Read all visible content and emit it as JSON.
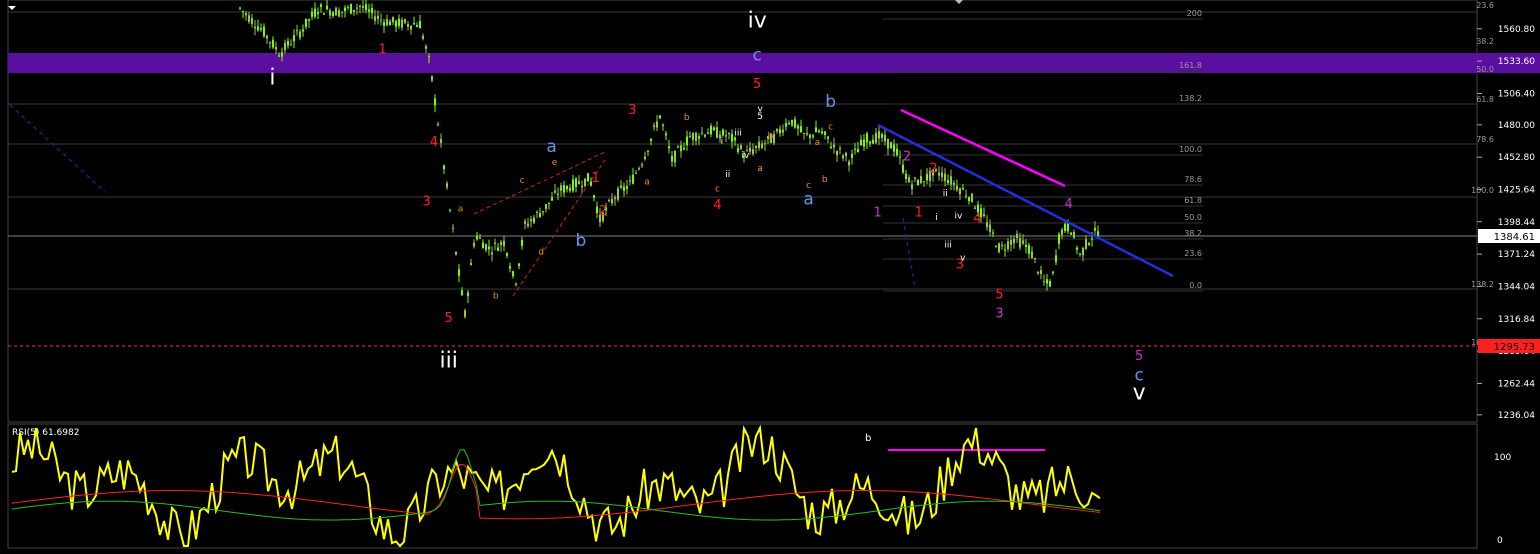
{
  "chart_data": [
    {
      "type": "candlestick",
      "panel": "price",
      "ylim": [
        1230,
        1585
      ],
      "yticks": [
        "1560.80",
        "1533.60",
        "1506.40",
        "1480.00",
        "1452.80",
        "1425.64",
        "1398.44",
        "1371.24",
        "1344.04",
        "1316.84",
        "1289.64",
        "1262.44",
        "1236.04"
      ],
      "current_price": "1384.61",
      "marked_price": "1295.73",
      "colors": {
        "bull": "#7cfc00",
        "bear": "#9acd32",
        "accent": "#ffffff"
      },
      "wave_labels": [
        {
          "t": "i",
          "x": 0.18,
          "price": 1514,
          "color": "#ffffff",
          "size": "large"
        },
        {
          "t": "iii",
          "x": 0.3,
          "price": 1276,
          "color": "#ffffff",
          "size": "large"
        },
        {
          "t": "iv",
          "x": 0.51,
          "price": 1562,
          "color": "#ffffff",
          "size": "large"
        },
        {
          "t": "v",
          "x": 0.77,
          "price": 1249,
          "color": "#ffffff",
          "size": "large"
        },
        {
          "t": "c",
          "x": 0.51,
          "price": 1534,
          "color": "#6495ed",
          "size": "medium"
        },
        {
          "t": "5",
          "x": 0.51,
          "price": 1511,
          "color": "#ff2020",
          "size": "small"
        },
        {
          "t": "a",
          "x": 0.37,
          "price": 1457,
          "color": "#6495ed",
          "size": "medium"
        },
        {
          "t": "b",
          "x": 0.39,
          "price": 1378,
          "color": "#6495ed",
          "size": "medium"
        },
        {
          "t": "b",
          "x": 0.56,
          "price": 1495,
          "color": "#6495ed",
          "size": "medium"
        },
        {
          "t": "a",
          "x": 0.545,
          "price": 1413,
          "color": "#6495ed",
          "size": "medium"
        },
        {
          "t": "c",
          "x": 0.77,
          "price": 1265,
          "color": "#6495ed",
          "size": "medium"
        },
        {
          "t": "5",
          "x": 0.77,
          "price": 1282,
          "color": "#cc33cc",
          "size": "small"
        },
        {
          "t": "1",
          "x": 0.255,
          "price": 1540,
          "color": "#ff2020",
          "size": "small"
        },
        {
          "t": "4",
          "x": 0.29,
          "price": 1462,
          "color": "#ff2020",
          "size": "small"
        },
        {
          "t": "3",
          "x": 0.285,
          "price": 1412,
          "color": "#ff2020",
          "size": "small"
        },
        {
          "t": "5",
          "x": 0.3,
          "price": 1314,
          "color": "#ff2020",
          "size": "small"
        },
        {
          "t": "3",
          "x": 0.425,
          "price": 1489,
          "color": "#ff2020",
          "size": "small"
        },
        {
          "t": "1",
          "x": 0.4,
          "price": 1432,
          "color": "#ff2020",
          "size": "small"
        },
        {
          "t": "2",
          "x": 0.405,
          "price": 1404,
          "color": "#ff2020",
          "size": "small"
        },
        {
          "t": "4",
          "x": 0.483,
          "price": 1409,
          "color": "#ff2020",
          "size": "small"
        },
        {
          "t": "1",
          "x": 0.62,
          "price": 1403,
          "color": "#ff2020",
          "size": "small"
        },
        {
          "t": "2",
          "x": 0.63,
          "price": 1440,
          "color": "#ff2020",
          "size": "small"
        },
        {
          "t": "4",
          "x": 0.66,
          "price": 1398,
          "color": "#ff2020",
          "size": "small"
        },
        {
          "t": "3",
          "x": 0.648,
          "price": 1359,
          "color": "#ff2020",
          "size": "small"
        },
        {
          "t": "5",
          "x": 0.675,
          "price": 1334,
          "color": "#ff2020",
          "size": "small"
        },
        {
          "t": "1",
          "x": 0.592,
          "price": 1403,
          "color": "#cc33cc",
          "size": "small"
        },
        {
          "t": "2",
          "x": 0.612,
          "price": 1450,
          "color": "#cc33cc",
          "size": "small"
        },
        {
          "t": "3",
          "x": 0.675,
          "price": 1318,
          "color": "#cc33cc",
          "size": "small"
        },
        {
          "t": "4",
          "x": 0.722,
          "price": 1410,
          "color": "#cc33cc",
          "size": "small"
        },
        {
          "t": "e",
          "x": 0.372,
          "price": 1446,
          "color": "#e09020",
          "size": "tiny"
        },
        {
          "t": "c",
          "x": 0.35,
          "price": 1431,
          "color": "#e09020",
          "size": "tiny"
        },
        {
          "t": "a",
          "x": 0.308,
          "price": 1407,
          "color": "#e09020",
          "size": "tiny"
        },
        {
          "t": "d",
          "x": 0.363,
          "price": 1371,
          "color": "#e09020",
          "size": "tiny"
        },
        {
          "t": "b",
          "x": 0.332,
          "price": 1334,
          "color": "#e09020",
          "size": "tiny"
        },
        {
          "t": "b",
          "x": 0.462,
          "price": 1484,
          "color": "#e09020",
          "size": "tiny"
        },
        {
          "t": "a",
          "x": 0.435,
          "price": 1430,
          "color": "#e09020",
          "size": "tiny"
        },
        {
          "t": "c",
          "x": 0.483,
          "price": 1424,
          "color": "#e09020",
          "size": "tiny"
        },
        {
          "t": "b",
          "x": 0.519,
          "price": 1468,
          "color": "#e09020",
          "size": "tiny"
        },
        {
          "t": "a",
          "x": 0.512,
          "price": 1441,
          "color": "#e09020",
          "size": "tiny"
        },
        {
          "t": "a",
          "x": 0.551,
          "price": 1463,
          "color": "#e09020",
          "size": "tiny"
        },
        {
          "t": "c",
          "x": 0.56,
          "price": 1476,
          "color": "#e09020",
          "size": "tiny"
        },
        {
          "t": "b",
          "x": 0.556,
          "price": 1432,
          "color": "#e09020",
          "size": "tiny"
        },
        {
          "t": "c",
          "x": 0.545,
          "price": 1427,
          "color": "#e09020",
          "size": "tiny"
        },
        {
          "t": "5",
          "x": 0.512,
          "price": 1485,
          "color": "#ffffff",
          "size": "tiny"
        },
        {
          "t": "v",
          "x": 0.512,
          "price": 1491,
          "color": "#ffffff",
          "size": "tiny"
        },
        {
          "t": "iii",
          "x": 0.497,
          "price": 1471,
          "color": "#ffffff",
          "size": "tiny"
        },
        {
          "t": "i",
          "x": 0.486,
          "price": 1464,
          "color": "#ffffff",
          "size": "tiny"
        },
        {
          "t": "iv",
          "x": 0.502,
          "price": 1452,
          "color": "#ffffff",
          "size": "tiny"
        },
        {
          "t": "ii",
          "x": 0.49,
          "price": 1436,
          "color": "#ffffff",
          "size": "tiny"
        },
        {
          "t": "ii",
          "x": 0.638,
          "price": 1420,
          "color": "#ffffff",
          "size": "tiny"
        },
        {
          "t": "i",
          "x": 0.632,
          "price": 1400,
          "color": "#ffffff",
          "size": "tiny"
        },
        {
          "t": "iv",
          "x": 0.647,
          "price": 1401,
          "color": "#ffffff",
          "size": "tiny"
        },
        {
          "t": "iii",
          "x": 0.64,
          "price": 1377,
          "color": "#ffffff",
          "size": "tiny"
        },
        {
          "t": "v",
          "x": 0.65,
          "price": 1366,
          "color": "#ffffff",
          "size": "tiny"
        }
      ],
      "fib_levels_right": [
        "200",
        "161.8",
        "138.2",
        "100.0",
        "78.6",
        "61.8",
        "50.0",
        "38.2",
        "23.6",
        "0.0"
      ],
      "fib_levels_far_right": [
        "23.6",
        "38.2",
        "50.0",
        "61.8",
        "78.6",
        "100.0",
        "138.2",
        "161.8"
      ]
    },
    {
      "type": "line",
      "panel": "indicator",
      "title": "RSI(5) 61.6982",
      "ylim": [
        0,
        100
      ],
      "yticks": [
        "100",
        "0"
      ],
      "annotation": "b",
      "series": [
        {
          "color": "#ffff00"
        },
        {
          "color": "#ff2020"
        },
        {
          "color": "#20c020"
        }
      ]
    }
  ]
}
